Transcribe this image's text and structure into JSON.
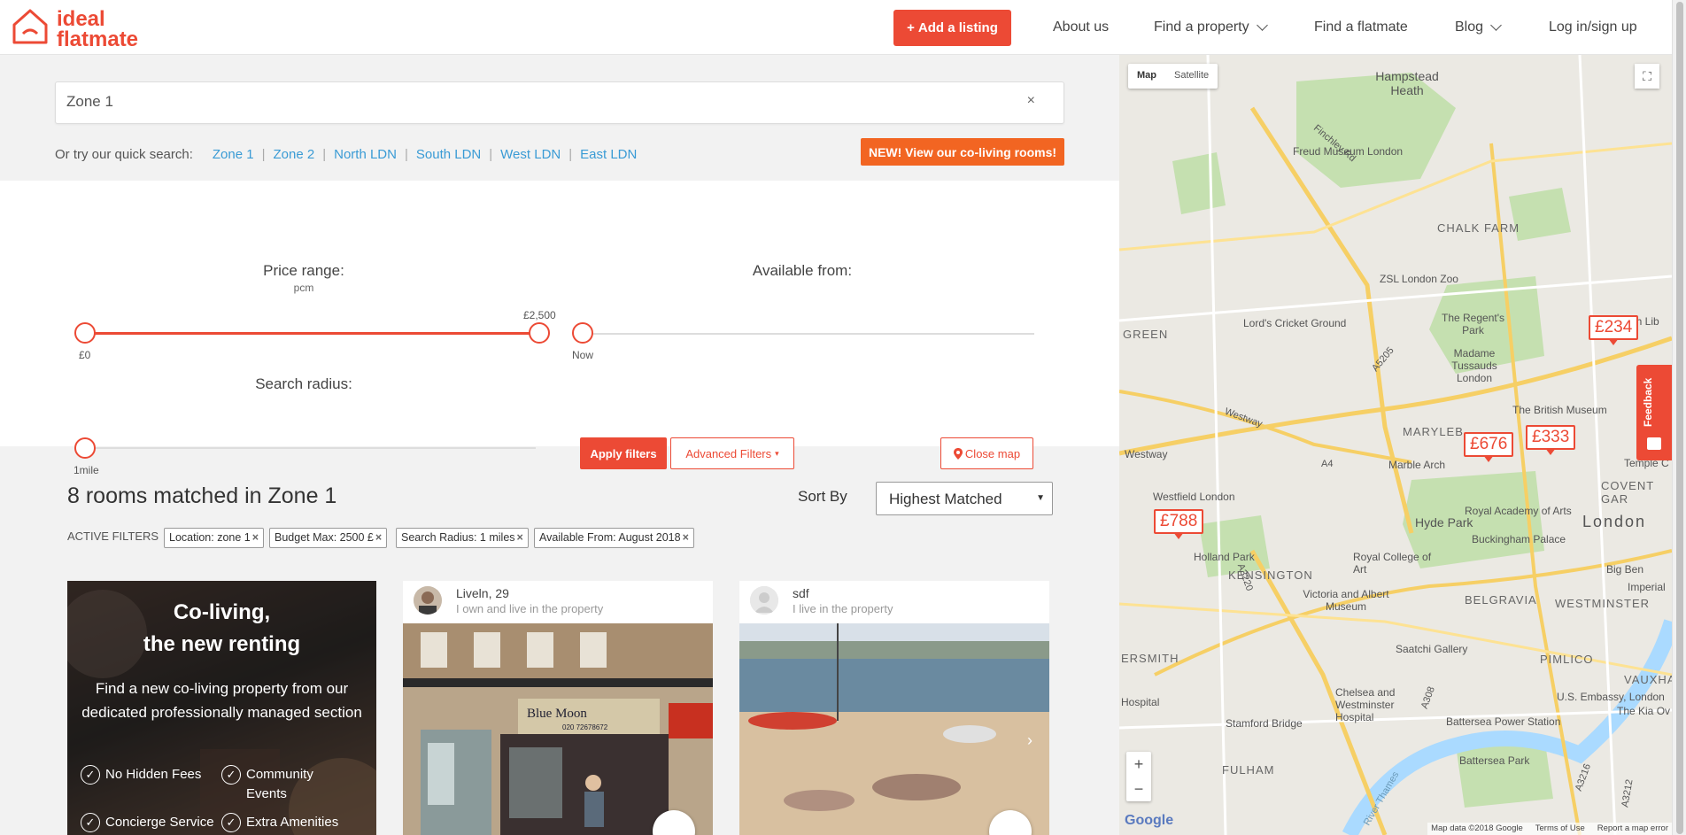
{
  "brand": {
    "logo_line1": "ideal",
    "logo_line2": "flatmate",
    "accent": "#ec4a35"
  },
  "nav": {
    "add_listing": "Add a listing",
    "about": "About us",
    "find_property": "Find a property",
    "find_flatmate": "Find a flatmate",
    "blog": "Blog",
    "login": "Log in/sign up"
  },
  "search": {
    "value": "Zone 1",
    "clear": "×"
  },
  "quick_search": {
    "label": "Or try our quick search:",
    "links": [
      "Zone 1",
      "Zone 2",
      "North LDN",
      "South LDN",
      "West LDN",
      "East LDN"
    ]
  },
  "coliving_badge": "NEW! View our co-living rooms!",
  "filters": {
    "price_title": "Price range:",
    "price_unit": "pcm",
    "price_min": "£0",
    "price_max": "£2,500",
    "available_title": "Available from:",
    "available_value": "Now",
    "radius_title": "Search radius:",
    "radius_value": "1mile",
    "apply": "Apply filters",
    "advanced": "Advanced Filters",
    "close_map": "Close map"
  },
  "results": {
    "title": "8 rooms matched in Zone 1",
    "sort_label": "Sort By",
    "sort_value": "Highest Matched",
    "active_filters_label": "ACTIVE FILTERS",
    "chips": [
      "Location: zone 1",
      "Budget Max: 2500 £",
      "Search Radius: 1 miles",
      "Available From: August 2018"
    ]
  },
  "promo": {
    "heading1": "Co-living,",
    "heading2": "the new renting",
    "text": "Find a new co-living property from our dedicated professionally managed section",
    "features": [
      "No Hidden Fees",
      "Community Events",
      "Concierge Service",
      "Extra Amenities"
    ]
  },
  "cards": [
    {
      "name": "Liveln, 29",
      "role": "I own and live in the property",
      "shop_sign": "Blue Moon",
      "shop_phone": "020 72678672"
    },
    {
      "name": "sdf",
      "role": "I live in the property"
    }
  ],
  "map": {
    "type_map": "Map",
    "type_satellite": "Satellite",
    "pins": [
      "£234",
      "£676",
      "£333",
      "£788"
    ],
    "places": [
      "Hampstead Heath",
      "Freud Museum London",
      "CHALK FARM",
      "ZSL London Zoo",
      "Lord's Cricket Ground",
      "The Regent's Park",
      "Madame Tussauds London",
      "The British Museum",
      "Marble Arch",
      "Westfield London",
      "Hyde Park",
      "Royal Academy of Arts",
      "Buckingham Palace",
      "London",
      "COVENT GAR",
      "Holland Park",
      "KENSINGTON",
      "Royal College of Art",
      "Victoria and Albert Museum",
      "BELGRAVIA",
      "WESTMINSTER",
      "Saatchi Gallery",
      "PIMLICO",
      "U.S. Embassy, London",
      "Chelsea and Westminster Hospital",
      "Battersea Power Station",
      "Stamford Bridge",
      "Battersea Park",
      "FULHAM",
      "GREEN",
      "Westway",
      "MARYLEB",
      "ERSMITH",
      "Hospital",
      "The British Lib",
      "Big Ben",
      "Imperial",
      "The Kia Ov",
      "VAUXHAL",
      "Temple C"
    ],
    "roads": [
      "Finchley Rd",
      "Westway",
      "A5205",
      "A3220",
      "A4",
      "A3216",
      "A308",
      "A3212",
      "River Thames"
    ],
    "attribution": "Map data ©2018 Google",
    "terms": "Terms of Use",
    "report": "Report a map error",
    "google": "Google"
  },
  "feedback": "Feedback"
}
